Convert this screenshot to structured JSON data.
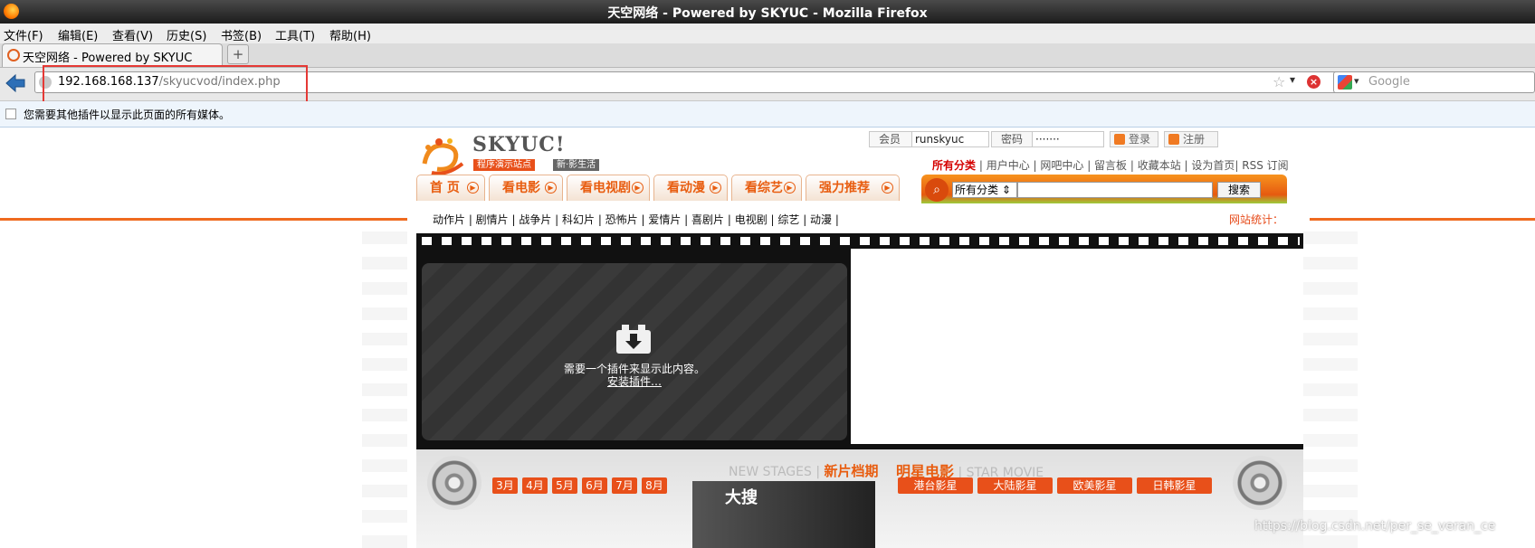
{
  "window": {
    "title": "天空网络 - Powered by SKYUC - Mozilla Firefox"
  },
  "menu": [
    "文件(F)",
    "编辑(E)",
    "查看(V)",
    "历史(S)",
    "书签(B)",
    "工具(T)",
    "帮助(H)"
  ],
  "tab": {
    "label": "天空网络 - Powered by SKYUC",
    "new_tab": "+"
  },
  "url": {
    "host": "192.168.168.137",
    "path": "/skyucvod/index.php"
  },
  "search_engine": {
    "placeholder": "Google"
  },
  "plugin_notice": "您需要其他插件以显示此页面的所有媒体。",
  "site": {
    "logo_text": "SKYUC!",
    "logo_sub1": "程序演示站点",
    "logo_sub2": "新·影生活",
    "login": {
      "member_label": "会员",
      "member_value": "runskyuc",
      "password_label": "密码",
      "password_value": "·······",
      "login_button": "登录",
      "register_button": "注册"
    },
    "toplinks": {
      "all": "所有分类",
      "rest": "| 用户中心 | 网吧中心 | 留言板 | 收藏本站 | 设为首页| RSS 订阅"
    },
    "nav": [
      "首 页",
      "看电影",
      "看电视剧",
      "看动漫",
      "看综艺",
      "强力推荐"
    ],
    "search": {
      "category": "所有分类",
      "button": "搜索"
    },
    "categories": "动作片 | 剧情片 | 战争片 | 科幻片 | 恐怖片 | 爱情片 | 喜剧片 | 电视剧 | 综艺 | 动漫 |",
    "stats": "网站统计：",
    "player": {
      "message": "需要一个插件来显示此内容。",
      "install": "安装插件…"
    },
    "new_stages": {
      "en": "NEW STAGES |",
      "zh": "新片档期"
    },
    "star_movie": {
      "zh": "明星电影",
      "en": "| STAR MOVIE"
    },
    "months": [
      "3月",
      "4月",
      "5月",
      "6月",
      "7月",
      "8月"
    ],
    "star_regions": [
      "港台影星",
      "大陆影星",
      "欧美影星",
      "日韩影星"
    ],
    "poster_text": "大搜"
  },
  "watermark": "https://blog.csdn.net/per_se_veran_ce",
  "colors": {
    "accent": "#e85d10",
    "brand_orange": "#f7931e",
    "hot_red": "#d40000"
  }
}
